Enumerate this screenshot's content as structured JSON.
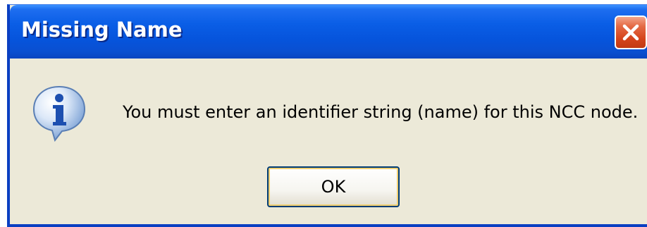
{
  "dialog": {
    "title": "Missing Name",
    "message": "You must enter an identifier string (name) for this NCC node.",
    "icon": "information-icon",
    "ok_label": "OK",
    "close_icon": "close-icon"
  },
  "colors": {
    "titlebar": "#0654dc",
    "body": "#ece9d8",
    "close_button": "#d5441c",
    "ok_border": "#003c74"
  }
}
